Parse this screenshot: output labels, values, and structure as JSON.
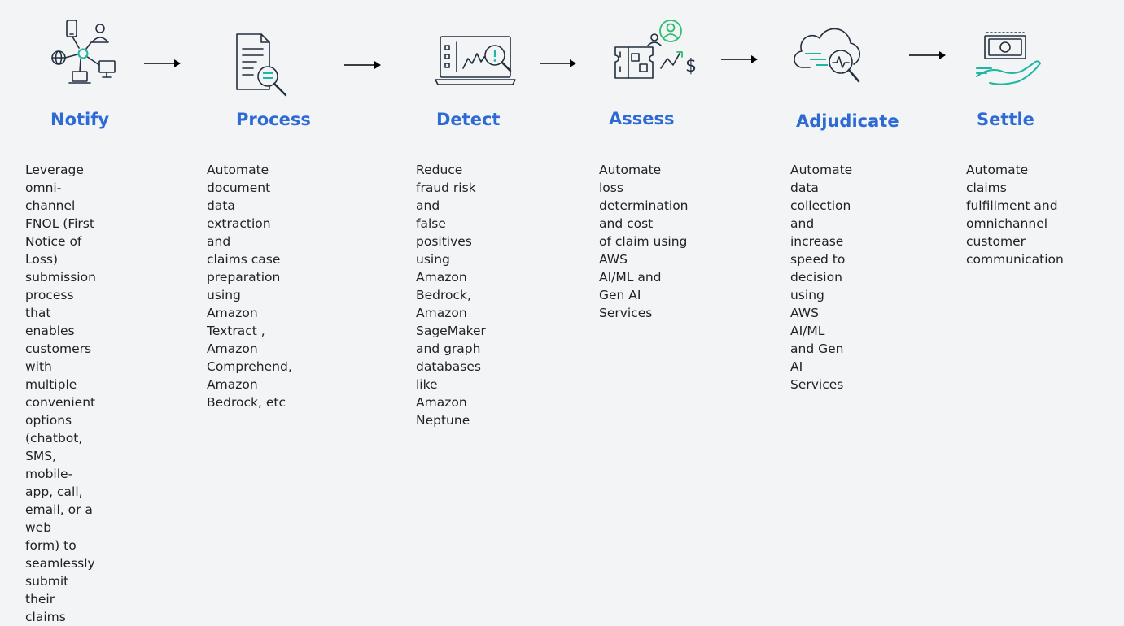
{
  "colors": {
    "title": "#2d6ad6",
    "icon_stroke": "#232f3e",
    "accent_teal": "#1fb6a3",
    "accent_green": "#2fbf71",
    "background": "#f3f4f5"
  },
  "steps": [
    {
      "title": "Notify",
      "icon": "omni-channel-network-icon",
      "description": "Leverage omni-channel\nFNOL (First Notice of\nLoss) submission process\nthat enables customers\nwith multiple\nconvenient options\n(chatbot, SMS, mobile-\napp, call, email, or a web\nform) to seamlessly\nsubmit their claims"
    },
    {
      "title": "Process",
      "icon": "document-search-icon",
      "description": "Automate document\ndata extraction and\nclaims case preparation\nusing Amazon Textract ,\nAmazon Comprehend,\nAmazon Bedrock, etc"
    },
    {
      "title": "Detect",
      "icon": "laptop-alert-icon",
      "description": "Reduce fraud risk and\nfalse positives using\nAmazon Bedrock,\nAmazon SageMaker\nand graph databases\nlike Amazon Neptune"
    },
    {
      "title": "Assess",
      "icon": "assess-cost-icon",
      "description": "Automate loss\ndetermination and cost\nof claim using AWS\nAI/ML and Gen AI\nServices"
    },
    {
      "title": "Adjudicate",
      "icon": "cloud-analytics-icon",
      "description": "Automate data\ncollection and increase\nspeed to decision using\nAWS AI/ML and Gen AI\nServices"
    },
    {
      "title": "Settle",
      "icon": "payment-hand-icon",
      "description": "Automate claims\nfulfillment and\nomnichannel customer\ncommunication"
    }
  ]
}
